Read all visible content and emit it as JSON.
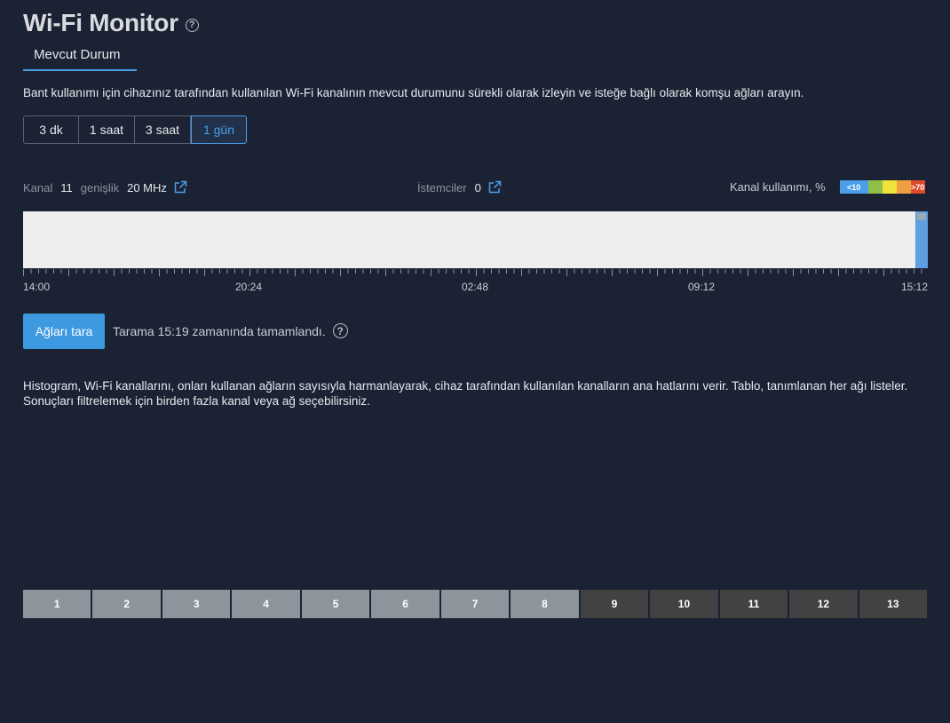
{
  "header": {
    "title": "Wi-Fi Monitor",
    "help_icon": "question-circle-icon"
  },
  "tabs": [
    {
      "label": "Mevcut Durum",
      "active": true
    }
  ],
  "description": "Bant kullanımı için cihazınız tarafından kullanılan Wi-Fi kanalının mevcut durumunu sürekli olarak izleyin ve isteğe bağlı olarak komşu ağları arayın.",
  "time_ranges": [
    {
      "label": "3 dk",
      "active": false
    },
    {
      "label": "1 saat",
      "active": false
    },
    {
      "label": "3 saat",
      "active": false
    },
    {
      "label": "1 gün",
      "active": true
    }
  ],
  "stats": {
    "channel_label": "Kanal",
    "channel_value": "11",
    "width_label": "genişlik",
    "width_value": "20 MHz",
    "clients_label": "İstemciler",
    "clients_value": "0",
    "usage_label": "Kanal kullanımı, %",
    "legend": [
      {
        "label": "<10",
        "color": "#4a9fe8"
      },
      {
        "label": "",
        "color": "#8fc04a"
      },
      {
        "label": "",
        "color": "#f0e23a"
      },
      {
        "label": "",
        "color": "#f0a040"
      },
      {
        "label": ">70",
        "color": "#e04a2a"
      }
    ]
  },
  "timeline": {
    "labels": [
      "14:00",
      "20:24",
      "02:48",
      "09:12",
      "15:12"
    ]
  },
  "scan": {
    "button_label": "Ağları tara",
    "status": "Tarama 15:19 zamanında tamamlandı."
  },
  "histogram_description": "Histogram, Wi-Fi kanallarını, onları kullanan ağların sayısıyla harmanlayarak, cihaz tarafından kullanılan kanalların ana hatlarını verir. Tablo, tanımlanan her ağı listeler. Sonuçları filtrelemek için birden fazla kanal veya ağ seçebilirsiniz.",
  "channels": [
    {
      "label": "1",
      "shade": "light"
    },
    {
      "label": "2",
      "shade": "light"
    },
    {
      "label": "3",
      "shade": "light"
    },
    {
      "label": "4",
      "shade": "light"
    },
    {
      "label": "5",
      "shade": "light"
    },
    {
      "label": "6",
      "shade": "light"
    },
    {
      "label": "7",
      "shade": "light"
    },
    {
      "label": "8",
      "shade": "light"
    },
    {
      "label": "9",
      "shade": "dark"
    },
    {
      "label": "10",
      "shade": "dark"
    },
    {
      "label": "11",
      "shade": "dark"
    },
    {
      "label": "12",
      "shade": "dark"
    },
    {
      "label": "13",
      "shade": "dark"
    }
  ]
}
